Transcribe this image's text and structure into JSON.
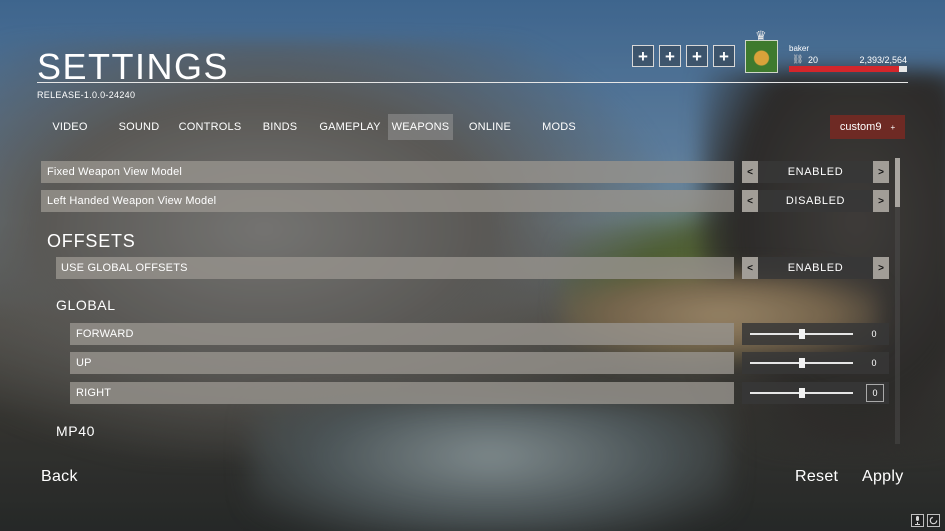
{
  "header": {
    "title": "SETTINGS",
    "version": "RELEASE-1.0.0-24240",
    "plus_buttons": [
      "+",
      "+",
      "+",
      "+"
    ]
  },
  "player": {
    "crown": "♛",
    "name": "baker",
    "level_icon": "⛓",
    "level": "20",
    "xp": "2,393/2,564",
    "xp_fraction": 0.933,
    "xp_color": "#d3262b"
  },
  "tabs": [
    {
      "label": "VIDEO",
      "active": false
    },
    {
      "label": "SOUND",
      "active": false
    },
    {
      "label": "CONTROLS",
      "active": false
    },
    {
      "label": "BINDS",
      "active": false
    },
    {
      "label": "GAMEPLAY",
      "active": false
    },
    {
      "label": "WEAPONS",
      "active": true
    },
    {
      "label": "ONLINE",
      "active": false
    },
    {
      "label": "MODS",
      "active": false
    }
  ],
  "custom_button": {
    "label": "custom9",
    "icon": "+",
    "color": "#6e2a24"
  },
  "options": [
    {
      "label": "Fixed Weapon View Model",
      "value": "ENABLED",
      "prev": "<",
      "next": ">"
    },
    {
      "label": "Left Handed Weapon View Model",
      "value": "DISABLED",
      "prev": "<",
      "next": ">"
    }
  ],
  "offsets": {
    "heading": "OFFSETS",
    "global_toggle": {
      "label": "USE GLOBAL OFFSETS",
      "value": "ENABLED",
      "prev": "<",
      "next": ">"
    },
    "global_heading": "GLOBAL",
    "sliders": [
      {
        "label": "FORWARD",
        "value": "0",
        "level": 0.5
      },
      {
        "label": "UP",
        "value": "0",
        "level": 0.5
      },
      {
        "label": "RIGHT",
        "value": "0",
        "level": 0.5
      }
    ],
    "next_heading": "MP40"
  },
  "footer": {
    "back": "Back",
    "reset": "Reset",
    "apply": "Apply"
  },
  "corner_icons": [
    "microphone-icon",
    "loading-icon"
  ]
}
